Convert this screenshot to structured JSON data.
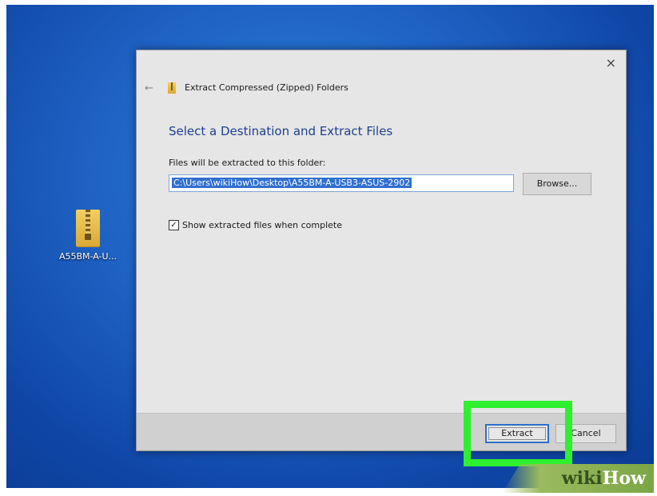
{
  "desktop": {
    "icon_label": "A55BM-A-U..."
  },
  "dialog": {
    "title": "Extract Compressed (Zipped) Folders",
    "close_glyph": "×",
    "back_glyph": "←",
    "heading": "Select a Destination and Extract Files",
    "path_label": "Files will be extracted to this folder:",
    "path_value": "C:\\Users\\wikiHow\\Desktop\\A55BM-A-USB3-ASUS-2902",
    "browse_label": "Browse...",
    "checkbox_label": "Show extracted files when complete",
    "checkbox_checked": true,
    "checkbox_glyph": "✓",
    "extract_label": "Extract",
    "cancel_label": "Cancel"
  },
  "annotation": {
    "highlight_color": "#2ef02e"
  },
  "watermark": {
    "wiki": "wiki",
    "how": "How"
  }
}
